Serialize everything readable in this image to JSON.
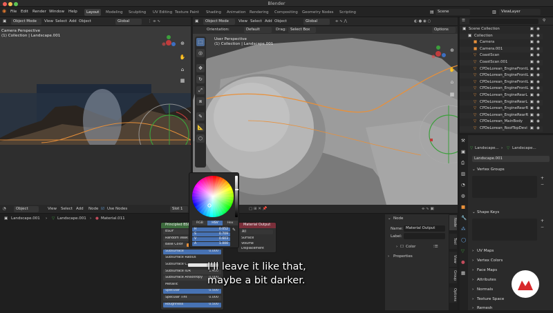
{
  "window": {
    "title": "Blender",
    "scene": "Scene",
    "view_layer": "ViewLayer"
  },
  "menu": [
    "File",
    "Edit",
    "Render",
    "Window",
    "Help"
  ],
  "workspaces": [
    {
      "label": "Layout",
      "active": true
    },
    {
      "label": "Modeling"
    },
    {
      "label": "Sculpting"
    },
    {
      "label": "UV Editing"
    },
    {
      "label": "Texture Paint"
    },
    {
      "label": "Shading"
    },
    {
      "label": "Animation"
    },
    {
      "label": "Rendering"
    },
    {
      "label": "Compositing"
    },
    {
      "label": "Geometry Nodes"
    },
    {
      "label": "Scripting"
    }
  ],
  "left_viewport": {
    "mode": "Object Mode",
    "menus": [
      "View",
      "Select",
      "Add",
      "Object"
    ],
    "transform": "Global",
    "overlay_line1": "Camera Perspective",
    "overlay_line2": "(1) Collection | Landscape.001"
  },
  "main_viewport": {
    "mode": "Object Mode",
    "menus": [
      "View",
      "Select",
      "Add",
      "Object"
    ],
    "transform": "Global",
    "orientation_label": "Orientation:",
    "orientation_value": "Default",
    "drag_label": "Drag:",
    "drag_value": "Select Box",
    "options": "Options",
    "overlay_line1": "User Perspective",
    "overlay_line2": "(1) Collection | Landscape.001"
  },
  "outliner": {
    "search_placeholder": "",
    "items": [
      {
        "label": "Scene Collection",
        "icon": "scene-collection-icon",
        "glyph": "▣",
        "indent": 0
      },
      {
        "label": "Collection",
        "icon": "collection-icon",
        "glyph": "▣",
        "indent": 1
      },
      {
        "label": "Camera",
        "icon": "camera-icon",
        "glyph": "■",
        "indent": 2
      },
      {
        "label": "Camera.001",
        "icon": "camera-icon",
        "glyph": "■",
        "indent": 2
      },
      {
        "label": "CoastScan",
        "icon": "mesh-icon",
        "glyph": "▽",
        "indent": 2
      },
      {
        "label": "CoastScan.001",
        "icon": "mesh-icon",
        "glyph": "▽",
        "indent": 2
      },
      {
        "label": "CPDeLorean_EngineFrontL",
        "icon": "mesh-icon",
        "glyph": "▽",
        "indent": 2
      },
      {
        "label": "CPDeLorean_EngineFrontL",
        "icon": "mesh-icon",
        "glyph": "▽",
        "indent": 2
      },
      {
        "label": "CPDeLorean_EngineFrontL",
        "icon": "mesh-icon",
        "glyph": "▽",
        "indent": 2
      },
      {
        "label": "CPDeLorean_EngineFrontL",
        "icon": "mesh-icon",
        "glyph": "▽",
        "indent": 2
      },
      {
        "label": "CPDeLorean_EngineRearL",
        "icon": "mesh-icon",
        "glyph": "▽",
        "indent": 2
      },
      {
        "label": "CPDeLorean_EngineRearL",
        "icon": "mesh-icon",
        "glyph": "▽",
        "indent": 2
      },
      {
        "label": "CPDeLorean_EngineRearR",
        "icon": "mesh-icon",
        "glyph": "▽",
        "indent": 2
      },
      {
        "label": "CPDeLorean_EngineRearR",
        "icon": "mesh-icon",
        "glyph": "▽",
        "indent": 2
      },
      {
        "label": "CPDeLorean_MainBody",
        "icon": "mesh-icon",
        "glyph": "▽",
        "indent": 2
      },
      {
        "label": "CPDeLorean_RoofTopDevi",
        "icon": "mesh-icon",
        "glyph": "▽",
        "indent": 2
      }
    ]
  },
  "properties": {
    "breadcrumb_object": "Landscape...",
    "breadcrumb_data": "Landscape...",
    "data_name": "Landscape.001",
    "panels": [
      "Vertex Groups",
      "Shape Keys",
      "UV Maps",
      "Vertex Colors",
      "Face Maps",
      "Attributes",
      "Normals",
      "Texture Space",
      "Remesh"
    ]
  },
  "node_editor": {
    "editor": "Object",
    "menus": [
      "View",
      "Select",
      "Add",
      "Node"
    ],
    "use_nodes": "Use Nodes",
    "slot": "Slot 1",
    "breadcrumb": [
      "Landscape.001",
      "Landscape.001",
      "Material.011"
    ],
    "principled": {
      "title": "Principled BSDF",
      "rows": [
        {
          "label": "BSDF"
        },
        {
          "label": "Random Walk"
        },
        {
          "label": "Base Color"
        },
        {
          "label": "Subsurface",
          "value": "0.000"
        },
        {
          "label": "Subsurface Radius"
        },
        {
          "label": "Subsurface C..."
        },
        {
          "label": "Subsurface IOR",
          "value": "1.400"
        },
        {
          "label": "Subsurface Anisotropy",
          "value": "0.000"
        },
        {
          "label": "Metallic"
        },
        {
          "label": "Specular",
          "value": "0.500"
        },
        {
          "label": "Specular Tint",
          "value": "0.000"
        },
        {
          "label": "Roughness",
          "value": "0.500"
        }
      ]
    },
    "material_output": {
      "title": "Material Output",
      "target": "All",
      "sockets": [
        "Surface",
        "Volume",
        "Displacement"
      ]
    },
    "color_picker": {
      "tabs": [
        "RGB",
        "HSV",
        "Hex"
      ],
      "active_tab": "HSV",
      "fields": [
        {
          "label": "H",
          "value": "0.052"
        },
        {
          "label": "S",
          "value": "0.709"
        },
        {
          "label": "V",
          "value": "0.603"
        },
        {
          "label": "A",
          "value": "1.000"
        }
      ]
    },
    "sidebar": {
      "section": "Node",
      "name_label": "Name:",
      "name_value": "Material Output",
      "label_label": "Label:",
      "color": "Color",
      "properties": "Properties"
    },
    "tabs": [
      "Node",
      "Tool",
      "View",
      "Group",
      "Options"
    ]
  },
  "subtitle": {
    "line1": "I'll leave it like that,",
    "line2": "maybe a bit darker."
  },
  "colors": {
    "accent": "#4772b3",
    "orange_highlight": "#e8903a",
    "node_header_green": "#3d6b3d",
    "node_header_red": "#7a2f3a",
    "logo_red": "#d8282b"
  }
}
